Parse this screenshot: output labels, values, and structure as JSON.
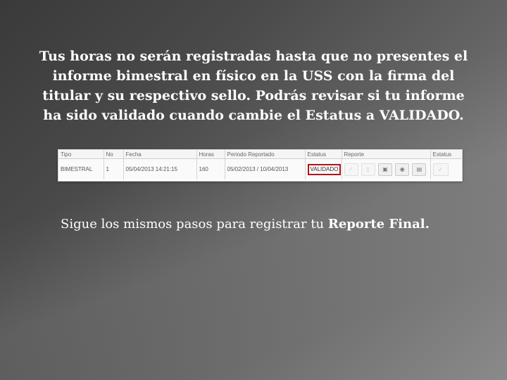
{
  "slide": {
    "heading_lines": [
      "Tus horas no serán registradas hasta que no presentes el",
      "informe bimestral en físico en la USS con la firma del",
      "titular y su respectivo sello. Podrás revisar si tu informe",
      "ha sido validado cuando cambie el Estatus a VALIDADO."
    ],
    "footer_prefix": "Sigue los mismos pasos para registrar tu ",
    "footer_bold": "Reporte Final."
  },
  "table": {
    "headers": [
      "Tipo",
      "No",
      "Fecha",
      "Horas",
      "Periodo Reportado",
      "Estatus",
      "Reporte",
      "Estatus"
    ],
    "row": {
      "tipo": "BIMESTRAL",
      "no": "1",
      "fecha": "05/04/2013 14:21:15",
      "horas": "160",
      "periodo": "05/02/2013 / 10/04/2013",
      "estatus": "VALIDADO"
    },
    "action_icons": [
      "check-icon",
      "document-icon",
      "save-icon",
      "view-icon",
      "print-icon"
    ],
    "status_icon": "check-icon"
  },
  "colors": {
    "highlight_border": "#b0131b",
    "text": "#ffffff"
  }
}
